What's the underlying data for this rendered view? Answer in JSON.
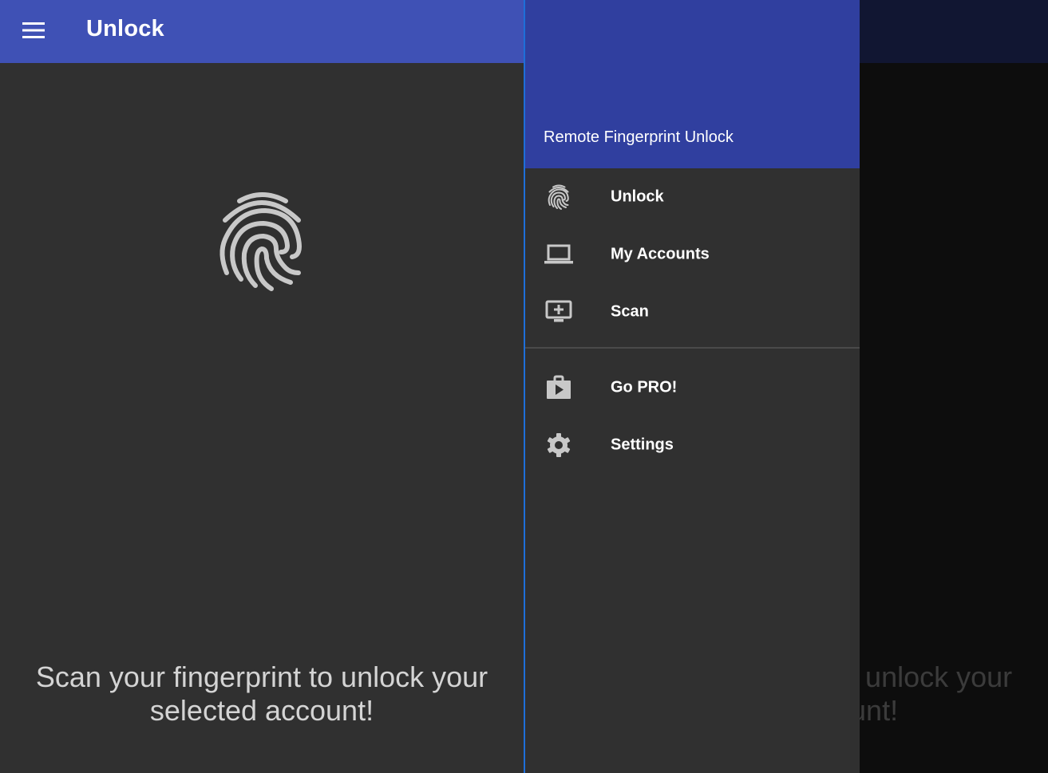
{
  "app_bar": {
    "menu_icon": "hamburger-menu-icon",
    "title": "Unlock"
  },
  "main": {
    "hero_icon": "fingerprint-icon",
    "message": "Scan your fingerprint to unlock your selected account!",
    "message_line1": "Scan your fingerprint to unlock your",
    "message_line2": "selected account!"
  },
  "drawer": {
    "header_title": "Remote Fingerprint Unlock",
    "primary_items": [
      {
        "label": "Unlock",
        "icon": "fingerprint-icon"
      },
      {
        "label": "My Accounts",
        "icon": "laptop-icon"
      },
      {
        "label": "Scan",
        "icon": "add-to-queue-icon"
      }
    ],
    "secondary_items": [
      {
        "label": "Go PRO!",
        "icon": "shop-icon"
      },
      {
        "label": "Settings",
        "icon": "gear-icon"
      }
    ]
  },
  "colors": {
    "app_bar": "#3f51b5",
    "drawer_header": "#303f9f",
    "background": "#303030",
    "drawer_edge": "#1e6fd9",
    "icon": "#c8c8c8",
    "text_primary": "#ffffff",
    "text_secondary": "#d4d4d4"
  }
}
